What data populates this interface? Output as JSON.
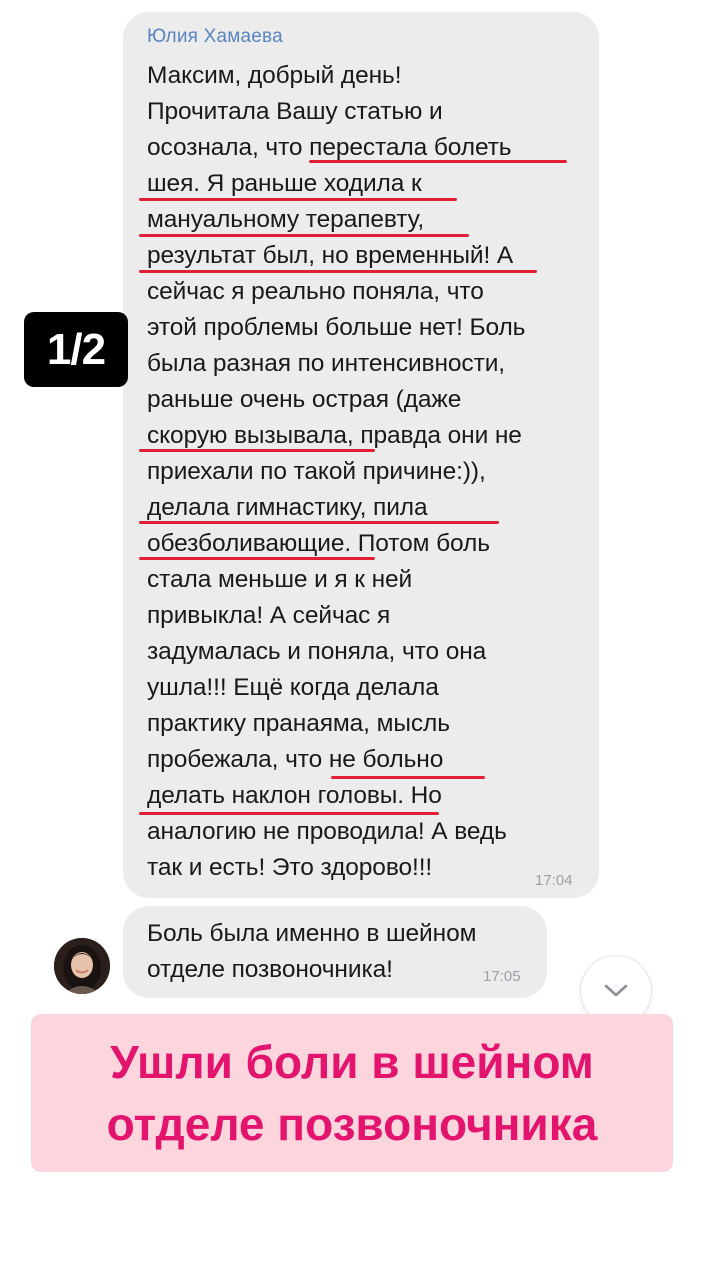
{
  "message": {
    "sender": "Юлия Хамаева",
    "lines": [
      "Максим, добрый день!",
      "Прочитала Вашу статью и",
      "осознала, что перестала болеть",
      "шея. Я раньше ходила к",
      "мануальному терапевту,",
      "результат был, но временный! А",
      "сейчас я реально поняла, что",
      "этой проблемы больше нет! Боль",
      "была разная по интенсивности,",
      "раньше очень острая (даже",
      "скорую вызывала, правда они не",
      "приехали по такой причине:)),",
      "делала гимнастику, пила",
      "обезболивающие. Потом боль",
      "стала меньше и я к ней",
      "привыкла! А сейчас я",
      "задумалась и поняла, что она",
      "ушла!!! Ещё когда делала",
      "практику пранаяма, мысль",
      "пробежала, что не больно",
      "делать наклон головы. Но",
      "аналогию не проводила! А ведь",
      "так и есть! Это здорово!!!"
    ],
    "time": "17:04"
  },
  "second_message": {
    "lines": [
      "Боль была именно в шейном",
      "отделе позвоночника!"
    ],
    "time": "17:05"
  },
  "page_indicator": "1/2",
  "caption": {
    "lines": [
      "Ушли боли в шейном",
      "отделе позвоночника"
    ]
  },
  "colors": {
    "bubble": "#ececed",
    "sender": "#5a84c2",
    "underline": "#e02034",
    "caption_bg": "#fdd6dd",
    "caption_text": "#e3146e"
  },
  "icons": {
    "scroll_down": "chevron-down-icon"
  }
}
